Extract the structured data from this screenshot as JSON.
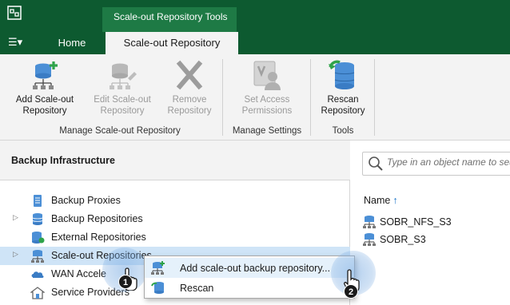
{
  "titlebar": {
    "tools_tab": "Scale-out Repository Tools"
  },
  "tabs": {
    "menu": "☰▾",
    "home": "Home",
    "active": "Scale-out Repository"
  },
  "ribbon": {
    "buttons": [
      {
        "label1": "Add Scale-out",
        "label2": "Repository",
        "icon": "add-repository-icon",
        "enabled": true
      },
      {
        "label1": "Edit Scale-out",
        "label2": "Repository",
        "icon": "edit-repository-icon",
        "enabled": false
      },
      {
        "label1": "Remove",
        "label2": "Repository",
        "icon": "remove-x-icon",
        "enabled": false
      },
      {
        "label1": "Set Access",
        "label2": "Permissions",
        "icon": "permissions-icon",
        "enabled": false
      },
      {
        "label1": "Rescan",
        "label2": "Repository",
        "icon": "rescan-icon",
        "enabled": true
      }
    ],
    "groups": {
      "manage_sobr": "Manage Scale-out Repository",
      "manage_settings": "Manage Settings",
      "tools": "Tools"
    }
  },
  "left_panel": {
    "header": "Backup Infrastructure",
    "items": [
      {
        "label": "Backup Proxies",
        "icon": "proxy-icon"
      },
      {
        "label": "Backup Repositories",
        "icon": "repository-icon"
      },
      {
        "label": "External Repositories",
        "icon": "external-repository-icon"
      },
      {
        "label": "Scale-out Repositories",
        "icon": "scale-out-repository-icon"
      },
      {
        "label": "WAN Accele",
        "icon": "wan-accelerator-icon"
      },
      {
        "label": "Service Providers",
        "icon": "service-provider-icon"
      }
    ]
  },
  "right_panel": {
    "search_placeholder": "Type in an object name to search for",
    "column_name": "Name",
    "sort_arrow": "↑",
    "objects": [
      "SOBR_NFS_S3",
      "SOBR_S3"
    ]
  },
  "context_menu": {
    "items": [
      {
        "label": "Add scale-out backup repository...",
        "icon": "add-repository-icon"
      },
      {
        "label": "Rescan",
        "icon": "rescan-icon"
      }
    ]
  },
  "steps": {
    "step1": "1",
    "step2": "2"
  },
  "colors": {
    "titlebar": "#0d5a30",
    "tools_tab": "#1e7a45",
    "selection": "#cfe4f7",
    "highlight": "#78aae1"
  }
}
